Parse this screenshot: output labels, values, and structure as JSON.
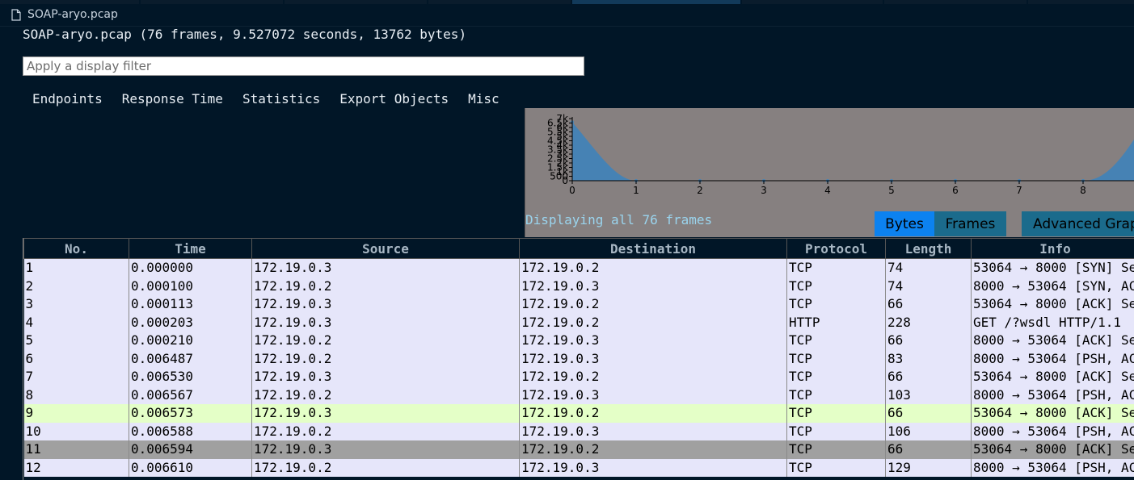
{
  "file_tab": {
    "title": "SOAP-aryo.pcap",
    "icon": "file-icon"
  },
  "summary": "SOAP-aryo.pcap (76 frames, 9.527072 seconds, 13762 bytes)",
  "filter": {
    "placeholder": "Apply a display filter",
    "value": ""
  },
  "menu": [
    "Endpoints",
    "Response Time",
    "Statistics",
    "Export Objects",
    "Misc"
  ],
  "graph": {
    "display_note": "Displaying all 76 frames",
    "buttons": {
      "bytes": "Bytes",
      "frames": "Frames",
      "advanced": "Advanced Graph"
    },
    "active_button": "bytes",
    "fill_color": "#4682b4",
    "y_ticks": [
      "7k",
      "6.5k",
      "6k",
      "5.5k",
      "5k",
      "4.5k",
      "4k",
      "3.5k",
      "3k",
      "2.5k",
      "2k",
      "1.5k",
      "1k",
      "500",
      "0"
    ],
    "x_ticks": [
      "0",
      "1",
      "2",
      "3",
      "4",
      "5",
      "6",
      "7",
      "8"
    ],
    "points": [
      {
        "x": 0,
        "y": 6600
      },
      {
        "x": 1,
        "y": 0
      },
      {
        "x": 2,
        "y": 0
      },
      {
        "x": 3,
        "y": 0
      },
      {
        "x": 4,
        "y": 0
      },
      {
        "x": 5,
        "y": 0
      },
      {
        "x": 6,
        "y": 0
      },
      {
        "x": 7,
        "y": 0
      },
      {
        "x": 8,
        "y": 0
      },
      {
        "x": 9,
        "y": 6900
      }
    ],
    "y_max": 7000
  },
  "table": {
    "columns": [
      "No.",
      "Time",
      "Source",
      "Destination",
      "Protocol",
      "Length",
      "Info"
    ],
    "highlight_row": 9,
    "selected_row": 11,
    "rows": [
      [
        "1",
        "0.000000",
        "172.19.0.3",
        "172.19.0.2",
        "TCP",
        "74",
        "53064 → 8000 [SYN] Se"
      ],
      [
        "2",
        "0.000100",
        "172.19.0.2",
        "172.19.0.3",
        "TCP",
        "74",
        "8000 → 53064 [SYN, AC"
      ],
      [
        "3",
        "0.000113",
        "172.19.0.3",
        "172.19.0.2",
        "TCP",
        "66",
        "53064 → 8000 [ACK] Se"
      ],
      [
        "4",
        "0.000203",
        "172.19.0.3",
        "172.19.0.2",
        "HTTP",
        "228",
        "GET /?wsdl HTTP/1.1"
      ],
      [
        "5",
        "0.000210",
        "172.19.0.2",
        "172.19.0.3",
        "TCP",
        "66",
        "8000 → 53064 [ACK] Se"
      ],
      [
        "6",
        "0.006487",
        "172.19.0.2",
        "172.19.0.3",
        "TCP",
        "83",
        "8000 → 53064 [PSH, AC"
      ],
      [
        "7",
        "0.006530",
        "172.19.0.3",
        "172.19.0.2",
        "TCP",
        "66",
        "53064 → 8000 [ACK] Se"
      ],
      [
        "8",
        "0.006567",
        "172.19.0.2",
        "172.19.0.3",
        "TCP",
        "103",
        "8000 → 53064 [PSH, AC"
      ],
      [
        "9",
        "0.006573",
        "172.19.0.3",
        "172.19.0.2",
        "TCP",
        "66",
        "53064 → 8000 [ACK] Se"
      ],
      [
        "10",
        "0.006588",
        "172.19.0.2",
        "172.19.0.3",
        "TCP",
        "106",
        "8000 → 53064 [PSH, AC"
      ],
      [
        "11",
        "0.006594",
        "172.19.0.3",
        "172.19.0.2",
        "TCP",
        "66",
        "53064 → 8000 [ACK] Se"
      ],
      [
        "12",
        "0.006610",
        "172.19.0.2",
        "172.19.0.3",
        "TCP",
        "129",
        "8000 → 53064 [PSH, AC"
      ]
    ]
  }
}
